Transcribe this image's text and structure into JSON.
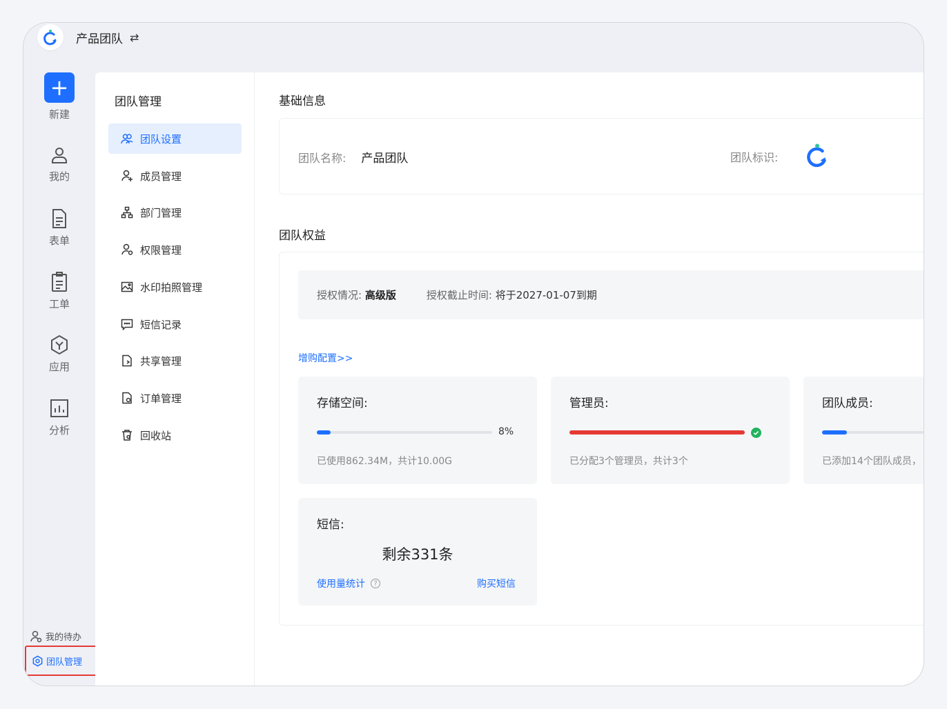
{
  "topbar": {
    "team_name": "产品团队",
    "switch_icon": "⇄"
  },
  "rail": {
    "new": "新建",
    "mine": "我的",
    "forms": "表单",
    "tickets": "工单",
    "apps": "应用",
    "analytics": "分析",
    "todo": "我的待办",
    "team_manage": "团队管理"
  },
  "subnav": {
    "title": "团队管理",
    "items": [
      {
        "label": "团队设置",
        "icon": "team-icon"
      },
      {
        "label": "成员管理",
        "icon": "member-icon"
      },
      {
        "label": "部门管理",
        "icon": "org-chart-icon"
      },
      {
        "label": "权限管理",
        "icon": "permission-icon"
      },
      {
        "label": "水印拍照管理",
        "icon": "watermark-photo-icon"
      },
      {
        "label": "短信记录",
        "icon": "message-icon"
      },
      {
        "label": "共享管理",
        "icon": "share-file-icon"
      },
      {
        "label": "订单管理",
        "icon": "order-file-icon"
      },
      {
        "label": "回收站",
        "icon": "recycle-bin-icon"
      }
    ]
  },
  "basic": {
    "title": "基础信息",
    "name_label": "团队名称:",
    "name_value": "产品团队",
    "logo_label": "团队标识:"
  },
  "benefits": {
    "title": "团队权益",
    "auth_label": "授权情况:",
    "auth_value": "高级版",
    "expire_label": "授权截止时间:",
    "expire_value": "将于2027-01-07到期",
    "buy_link": "增购配置>>",
    "storage": {
      "title": "存储空间:",
      "percent": 8,
      "percent_text": "8%",
      "desc": "已使用862.34M，共计10.00G"
    },
    "admins": {
      "title": "管理员:",
      "percent": 100,
      "desc": "已分配3个管理员，共计3个"
    },
    "members": {
      "title": "团队成员:",
      "percent": 14,
      "desc": "已添加14个团队成员，"
    },
    "sms": {
      "title": "短信:",
      "remaining": "剩余331条",
      "usage_link": "使用量统计",
      "buy_link": "购买短信"
    }
  },
  "colors": {
    "accent": "#1e6fff",
    "danger": "#e53935",
    "success": "#22b35e"
  }
}
